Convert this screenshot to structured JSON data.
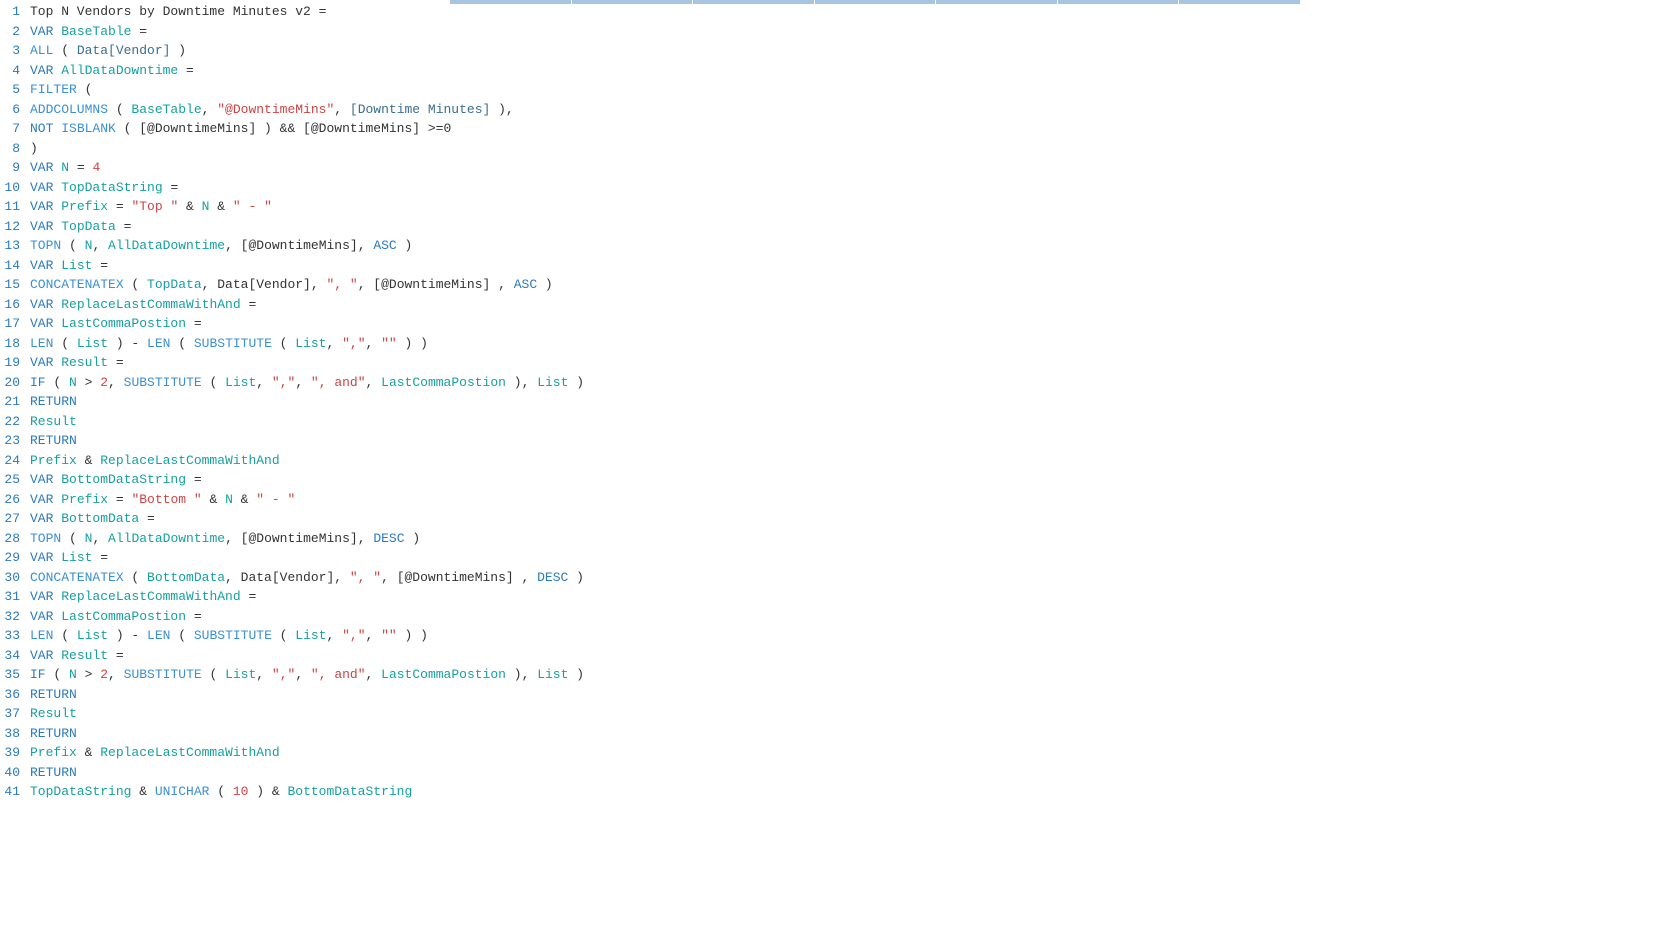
{
  "lines": [
    {
      "n": "1",
      "tokens": [
        [
          "txt",
          "Top N Vendors by Downtime Minutes v2 = "
        ]
      ]
    },
    {
      "n": "2",
      "tokens": [
        [
          "kw",
          "VAR "
        ],
        [
          "id",
          "BaseTable"
        ],
        [
          "txt",
          " ="
        ]
      ]
    },
    {
      "n": "3",
      "tokens": [
        [
          "fn",
          "ALL"
        ],
        [
          "txt",
          " ( "
        ],
        [
          "col",
          "Data[Vendor]"
        ],
        [
          "txt",
          " )"
        ]
      ]
    },
    {
      "n": "4",
      "tokens": [
        [
          "kw",
          "VAR "
        ],
        [
          "id",
          "AllDataDowntime"
        ],
        [
          "txt",
          " ="
        ]
      ]
    },
    {
      "n": "5",
      "tokens": [
        [
          "fn",
          "FILTER"
        ],
        [
          "txt",
          " ("
        ]
      ]
    },
    {
      "n": "6",
      "tokens": [
        [
          "fn",
          "ADDCOLUMNS"
        ],
        [
          "txt",
          " ( "
        ],
        [
          "id",
          "BaseTable"
        ],
        [
          "txt",
          ", "
        ],
        [
          "str",
          "\"@DowntimeMins\""
        ],
        [
          "txt",
          ", "
        ],
        [
          "col",
          "[Downtime Minutes]"
        ],
        [
          "txt",
          " ),"
        ]
      ]
    },
    {
      "n": "7",
      "tokens": [
        [
          "kw",
          "NOT "
        ],
        [
          "fn",
          "ISBLANK"
        ],
        [
          "txt",
          " ( [@DowntimeMins] ) && [@DowntimeMins] >=0"
        ]
      ]
    },
    {
      "n": "8",
      "tokens": [
        [
          "txt",
          ")"
        ]
      ]
    },
    {
      "n": "9",
      "tokens": [
        [
          "kw",
          "VAR "
        ],
        [
          "id",
          "N"
        ],
        [
          "txt",
          " = "
        ],
        [
          "num",
          "4"
        ]
      ]
    },
    {
      "n": "10",
      "tokens": [
        [
          "kw",
          "VAR "
        ],
        [
          "id",
          "TopDataString"
        ],
        [
          "txt",
          " ="
        ]
      ]
    },
    {
      "n": "11",
      "tokens": [
        [
          "kw",
          "VAR "
        ],
        [
          "id",
          "Prefix"
        ],
        [
          "txt",
          " = "
        ],
        [
          "str",
          "\"Top \""
        ],
        [
          "txt",
          " & "
        ],
        [
          "id",
          "N"
        ],
        [
          "txt",
          " & "
        ],
        [
          "str",
          "\" - \""
        ]
      ]
    },
    {
      "n": "12",
      "tokens": [
        [
          "kw",
          "VAR "
        ],
        [
          "id",
          "TopData"
        ],
        [
          "txt",
          " ="
        ]
      ]
    },
    {
      "n": "13",
      "tokens": [
        [
          "fn",
          "TOPN"
        ],
        [
          "txt",
          " ( "
        ],
        [
          "id",
          "N"
        ],
        [
          "txt",
          ", "
        ],
        [
          "id",
          "AllDataDowntime"
        ],
        [
          "txt",
          ", [@DowntimeMins], "
        ],
        [
          "kw",
          "ASC"
        ],
        [
          "txt",
          " )"
        ]
      ]
    },
    {
      "n": "14",
      "tokens": [
        [
          "kw",
          "VAR "
        ],
        [
          "id",
          "List"
        ],
        [
          "txt",
          " ="
        ]
      ]
    },
    {
      "n": "15",
      "tokens": [
        [
          "fn",
          "CONCATENATEX"
        ],
        [
          "txt",
          " ( "
        ],
        [
          "id",
          "TopData"
        ],
        [
          "txt",
          ", Data[Vendor], "
        ],
        [
          "str",
          "\", \""
        ],
        [
          "txt",
          ", [@DowntimeMins] , "
        ],
        [
          "kw",
          "ASC"
        ],
        [
          "txt",
          " )"
        ]
      ]
    },
    {
      "n": "16",
      "tokens": [
        [
          "kw",
          "VAR "
        ],
        [
          "id",
          "ReplaceLastCommaWithAnd"
        ],
        [
          "txt",
          " ="
        ]
      ]
    },
    {
      "n": "17",
      "tokens": [
        [
          "kw",
          "VAR "
        ],
        [
          "id",
          "LastCommaPostion"
        ],
        [
          "txt",
          " ="
        ]
      ]
    },
    {
      "n": "18",
      "tokens": [
        [
          "fn",
          "LEN"
        ],
        [
          "txt",
          " ( "
        ],
        [
          "id",
          "List"
        ],
        [
          "txt",
          " ) - "
        ],
        [
          "fn",
          "LEN"
        ],
        [
          "txt",
          " ( "
        ],
        [
          "fn",
          "SUBSTITUTE"
        ],
        [
          "txt",
          " ( "
        ],
        [
          "id",
          "List"
        ],
        [
          "txt",
          ", "
        ],
        [
          "str",
          "\",\""
        ],
        [
          "txt",
          ", "
        ],
        [
          "str",
          "\"\""
        ],
        [
          "txt",
          " ) )"
        ]
      ]
    },
    {
      "n": "19",
      "tokens": [
        [
          "kw",
          "VAR "
        ],
        [
          "id",
          "Result"
        ],
        [
          "txt",
          " ="
        ]
      ]
    },
    {
      "n": "20",
      "tokens": [
        [
          "kw",
          "IF"
        ],
        [
          "txt",
          " ( "
        ],
        [
          "id",
          "N"
        ],
        [
          "txt",
          " > "
        ],
        [
          "num",
          "2"
        ],
        [
          "txt",
          ", "
        ],
        [
          "fn",
          "SUBSTITUTE"
        ],
        [
          "txt",
          " ( "
        ],
        [
          "id",
          "List"
        ],
        [
          "txt",
          ", "
        ],
        [
          "str",
          "\",\""
        ],
        [
          "txt",
          ", "
        ],
        [
          "str",
          "\", and\""
        ],
        [
          "txt",
          ", "
        ],
        [
          "id",
          "LastCommaPostion"
        ],
        [
          "txt",
          " ), "
        ],
        [
          "id",
          "List"
        ],
        [
          "txt",
          " )"
        ]
      ]
    },
    {
      "n": "21",
      "tokens": [
        [
          "kw",
          "RETURN"
        ]
      ]
    },
    {
      "n": "22",
      "tokens": [
        [
          "id",
          "Result"
        ]
      ]
    },
    {
      "n": "23",
      "tokens": [
        [
          "kw",
          "RETURN"
        ]
      ]
    },
    {
      "n": "24",
      "tokens": [
        [
          "id",
          "Prefix"
        ],
        [
          "txt",
          " & "
        ],
        [
          "id",
          "ReplaceLastCommaWithAnd"
        ]
      ]
    },
    {
      "n": "25",
      "tokens": [
        [
          "kw",
          "VAR "
        ],
        [
          "id",
          "BottomDataString"
        ],
        [
          "txt",
          " ="
        ]
      ]
    },
    {
      "n": "26",
      "tokens": [
        [
          "kw",
          "VAR "
        ],
        [
          "id",
          "Prefix"
        ],
        [
          "txt",
          " = "
        ],
        [
          "str",
          "\"Bottom \""
        ],
        [
          "txt",
          " & "
        ],
        [
          "id",
          "N"
        ],
        [
          "txt",
          " & "
        ],
        [
          "str",
          "\" - \""
        ]
      ]
    },
    {
      "n": "27",
      "tokens": [
        [
          "kw",
          "VAR "
        ],
        [
          "id",
          "BottomData"
        ],
        [
          "txt",
          " ="
        ]
      ]
    },
    {
      "n": "28",
      "tokens": [
        [
          "fn",
          "TOPN"
        ],
        [
          "txt",
          " ( "
        ],
        [
          "id",
          "N"
        ],
        [
          "txt",
          ", "
        ],
        [
          "id",
          "AllDataDowntime"
        ],
        [
          "txt",
          ", [@DowntimeMins], "
        ],
        [
          "kw",
          "DESC"
        ],
        [
          "txt",
          " )"
        ]
      ]
    },
    {
      "n": "29",
      "tokens": [
        [
          "kw",
          "VAR "
        ],
        [
          "id",
          "List"
        ],
        [
          "txt",
          " ="
        ]
      ]
    },
    {
      "n": "30",
      "tokens": [
        [
          "fn",
          "CONCATENATEX"
        ],
        [
          "txt",
          " ( "
        ],
        [
          "id",
          "BottomData"
        ],
        [
          "txt",
          ", Data[Vendor], "
        ],
        [
          "str",
          "\", \""
        ],
        [
          "txt",
          ", [@DowntimeMins] , "
        ],
        [
          "kw",
          "DESC"
        ],
        [
          "txt",
          " )"
        ]
      ]
    },
    {
      "n": "31",
      "tokens": [
        [
          "kw",
          "VAR "
        ],
        [
          "id",
          "ReplaceLastCommaWithAnd"
        ],
        [
          "txt",
          " ="
        ]
      ]
    },
    {
      "n": "32",
      "tokens": [
        [
          "kw",
          "VAR "
        ],
        [
          "id",
          "LastCommaPostion"
        ],
        [
          "txt",
          " ="
        ]
      ]
    },
    {
      "n": "33",
      "tokens": [
        [
          "fn",
          "LEN"
        ],
        [
          "txt",
          " ( "
        ],
        [
          "id",
          "List"
        ],
        [
          "txt",
          " ) - "
        ],
        [
          "fn",
          "LEN"
        ],
        [
          "txt",
          " ( "
        ],
        [
          "fn",
          "SUBSTITUTE"
        ],
        [
          "txt",
          " ( "
        ],
        [
          "id",
          "List"
        ],
        [
          "txt",
          ", "
        ],
        [
          "str",
          "\",\""
        ],
        [
          "txt",
          ", "
        ],
        [
          "str",
          "\"\""
        ],
        [
          "txt",
          " ) )"
        ]
      ]
    },
    {
      "n": "34",
      "tokens": [
        [
          "kw",
          "VAR "
        ],
        [
          "id",
          "Result"
        ],
        [
          "txt",
          " ="
        ]
      ]
    },
    {
      "n": "35",
      "tokens": [
        [
          "kw",
          "IF"
        ],
        [
          "txt",
          " ( "
        ],
        [
          "id",
          "N"
        ],
        [
          "txt",
          " > "
        ],
        [
          "num",
          "2"
        ],
        [
          "txt",
          ", "
        ],
        [
          "fn",
          "SUBSTITUTE"
        ],
        [
          "txt",
          " ( "
        ],
        [
          "id",
          "List"
        ],
        [
          "txt",
          ", "
        ],
        [
          "str",
          "\",\""
        ],
        [
          "txt",
          ", "
        ],
        [
          "str",
          "\", and\""
        ],
        [
          "txt",
          ", "
        ],
        [
          "id",
          "LastCommaPostion"
        ],
        [
          "txt",
          " ), "
        ],
        [
          "id",
          "List"
        ],
        [
          "txt",
          " )"
        ]
      ]
    },
    {
      "n": "36",
      "tokens": [
        [
          "kw",
          "RETURN"
        ]
      ]
    },
    {
      "n": "37",
      "tokens": [
        [
          "id",
          "Result"
        ]
      ]
    },
    {
      "n": "38",
      "tokens": [
        [
          "kw",
          "RETURN"
        ]
      ]
    },
    {
      "n": "39",
      "tokens": [
        [
          "id",
          "Prefix"
        ],
        [
          "txt",
          " & "
        ],
        [
          "id",
          "ReplaceLastCommaWithAnd"
        ]
      ]
    },
    {
      "n": "40",
      "tokens": [
        [
          "kw",
          "RETURN"
        ]
      ]
    },
    {
      "n": "41",
      "tokens": [
        [
          "id",
          "TopDataString"
        ],
        [
          "txt",
          " & "
        ],
        [
          "fn",
          "UNICHAR"
        ],
        [
          "txt",
          " ( "
        ],
        [
          "num",
          "10"
        ],
        [
          "txt",
          " ) & "
        ],
        [
          "id",
          "BottomDataString"
        ]
      ]
    }
  ]
}
